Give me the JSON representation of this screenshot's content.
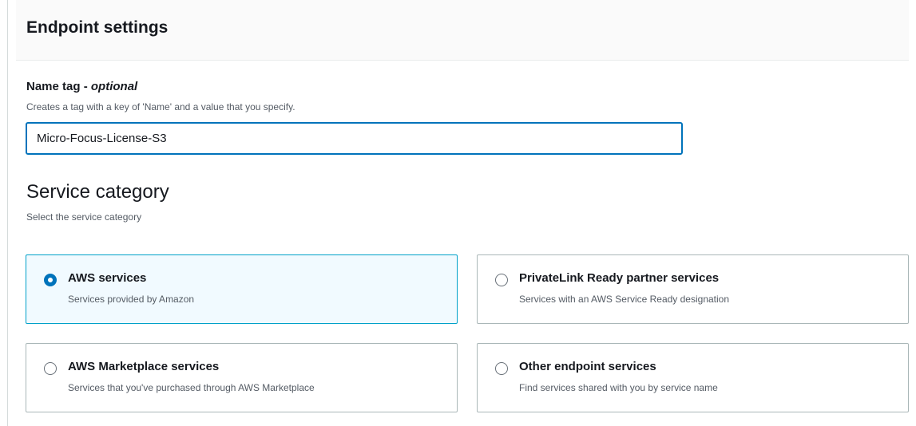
{
  "header": {
    "title": "Endpoint settings"
  },
  "name_tag": {
    "label": "Name tag",
    "optional": "optional",
    "separator": " - ",
    "description": "Creates a tag with a key of 'Name' and a value that you specify.",
    "value": "Micro-Focus-License-S3"
  },
  "service_category": {
    "title": "Service category",
    "description": "Select the service category",
    "options": [
      {
        "title": "AWS services",
        "description": "Services provided by Amazon",
        "selected": true
      },
      {
        "title": "PrivateLink Ready partner services",
        "description": "Services with an AWS Service Ready designation",
        "selected": false
      },
      {
        "title": "AWS Marketplace services",
        "description": "Services that you've purchased through AWS Marketplace",
        "selected": false
      },
      {
        "title": "Other endpoint services",
        "description": "Find services shared with you by service name",
        "selected": false
      }
    ]
  },
  "colors": {
    "accent": "#0073bb",
    "selected_border": "#00a1c9",
    "selected_background": "#f1faff"
  }
}
